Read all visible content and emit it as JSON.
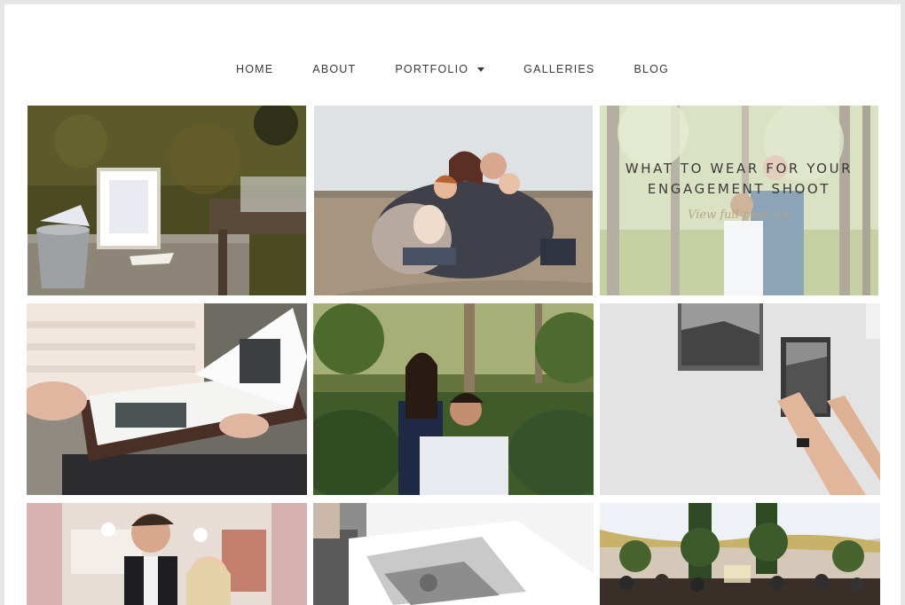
{
  "nav": {
    "items": [
      {
        "label": "HOME"
      },
      {
        "label": "ABOUT"
      },
      {
        "label": "PORTFOLIO",
        "has_dropdown": true
      },
      {
        "label": "GALLERIES"
      },
      {
        "label": "BLOG"
      }
    ]
  },
  "featured_post": {
    "title": "WHAT TO WEAR FOR YOUR ENGAGEMENT SHOOT",
    "link_text": "View full post >>"
  },
  "gallery": [
    {
      "subject": "rustic guest book table with jars"
    },
    {
      "subject": "family hugging on beach"
    },
    {
      "subject": "engagement couple in forest"
    },
    {
      "subject": "woman holding photo album"
    },
    {
      "subject": "couple embracing in garden"
    },
    {
      "subject": "hanging canvas prints on wall"
    },
    {
      "subject": "bride and groom portrait"
    },
    {
      "subject": "open photo book"
    },
    {
      "subject": "wedding reception with greenery"
    }
  ],
  "colors": {
    "page_bg": "#e6e6e6",
    "content_bg": "#ffffff",
    "nav_text": "#3a3a3a",
    "link_accent": "#b4a781"
  }
}
